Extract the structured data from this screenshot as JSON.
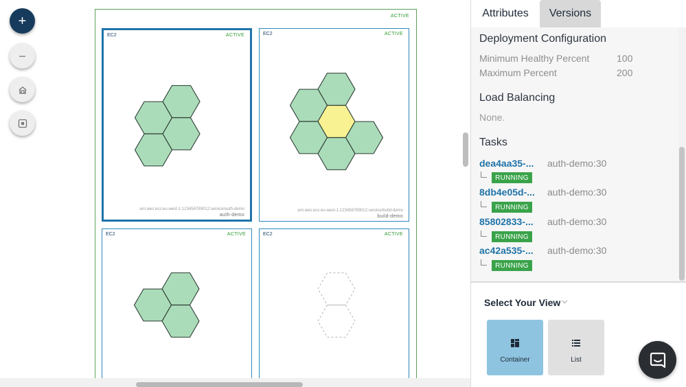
{
  "zoom_controls": {
    "zoom_in_glyph": "+",
    "zoom_out_glyph": "−",
    "icons": [
      "plus-icon",
      "minus-icon",
      "recenter-icon",
      "fit-icon"
    ]
  },
  "cluster": {
    "status": "ACTIVE",
    "cards": [
      {
        "type": "EC2",
        "status": "ACTIVE",
        "arn": "arn:aws:ecs:eu-west-1:123456789012:service/auth-demo",
        "service": "auth-demo",
        "selected": true
      },
      {
        "type": "EC2",
        "status": "ACTIVE",
        "arn": "arn:aws:ecs:eu-west-1:123456789012:service/build-demo",
        "service": "build-demo",
        "selected": false
      },
      {
        "type": "EC2",
        "status": "ACTIVE",
        "arn": "",
        "service": "",
        "selected": false
      },
      {
        "type": "EC2",
        "status": "ACTIVE",
        "arn": "",
        "service": "",
        "selected": false
      }
    ]
  },
  "panel": {
    "tabs": [
      "Attributes",
      "Versions"
    ],
    "active_tab": "Versions",
    "deployment": {
      "title": "Deployment Configuration",
      "rows": [
        {
          "label": "Minimum Healthy Percent",
          "value": "100"
        },
        {
          "label": "Maximum Percent",
          "value": "200"
        }
      ]
    },
    "load_balancing": {
      "title": "Load Balancing",
      "value": "None."
    },
    "tasks": {
      "title": "Tasks",
      "items": [
        {
          "id": "dea4aa35-...",
          "definition": "auth-demo:30",
          "status": "RUNNING"
        },
        {
          "id": "8db4e05d-...",
          "definition": "auth-demo:30",
          "status": "RUNNING"
        },
        {
          "id": "85802833-...",
          "definition": "auth-demo:30",
          "status": "RUNNING"
        },
        {
          "id": "ac42a535-...",
          "definition": "auth-demo:30",
          "status": "RUNNING"
        }
      ]
    },
    "view_selector": {
      "label": "Select Your View",
      "options": [
        "Container",
        "List"
      ],
      "selected": "Container"
    }
  },
  "colors": {
    "hex_running": "#abdcb9",
    "hex_pending": "#f8f293",
    "hex_stroke": "#2b3a33",
    "accent": "#1f73a8",
    "badge_green": "#3aa34a"
  }
}
